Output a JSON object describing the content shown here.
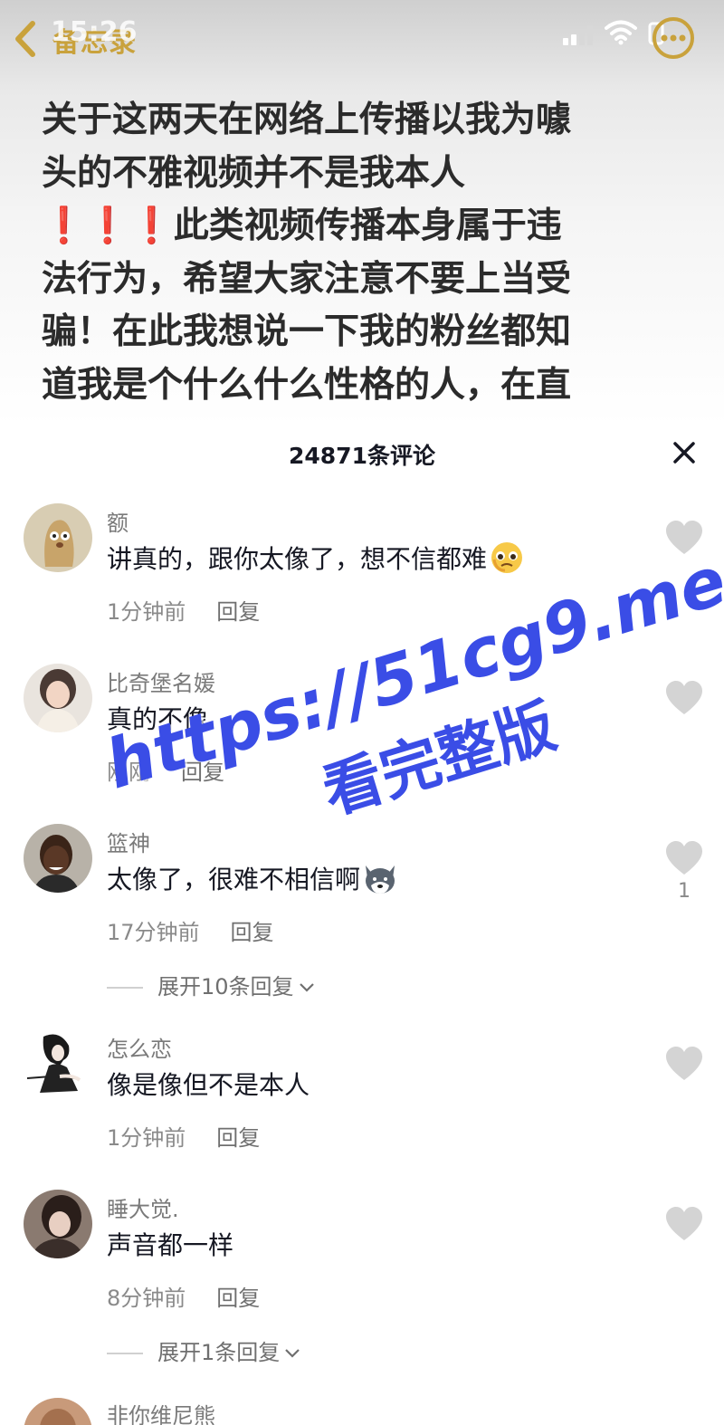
{
  "status_bar": {
    "time": "15:26",
    "back_label": "备忘录"
  },
  "post": {
    "line1": "关于这两天在网络上传播以我为噱",
    "line2": "头的不雅视频并不是我本人",
    "exclamations": "❗❗❗",
    "line3_rest": "此类视频传播本身属于违",
    "line4": "法行为，希望大家注意不要上当受",
    "line5": "骗！在此我想说一下我的粉丝都知",
    "line6": "道我是个什么什么性格的人，在直"
  },
  "comments_panel": {
    "title": "24871条评论",
    "reply_label": "回复",
    "comments": [
      {
        "username": "额",
        "text": "讲真的，跟你太像了，想不信都难",
        "emoji": "pleading-face-emoji",
        "time": "1分钟前",
        "likes": ""
      },
      {
        "username": "比奇堡名媛",
        "text": "真的不像",
        "time": "刚刚",
        "likes": ""
      },
      {
        "username": "篮神",
        "text": "太像了，很难不相信啊",
        "emoji": "husky-face-emoji",
        "time": "17分钟前",
        "likes": "1",
        "expand": "展开10条回复"
      },
      {
        "username": "怎么恋",
        "text": "像是像但不是本人",
        "time": "1分钟前",
        "likes": ""
      },
      {
        "username": "睡大觉.",
        "text": "声音都一样",
        "time": "8分钟前",
        "likes": "",
        "expand": "展开1条回复"
      },
      {
        "username": "非你维尼熊",
        "text": "",
        "time": ""
      }
    ]
  },
  "watermark": {
    "url": "https://51cg9.me",
    "subtitle": "看完整版"
  },
  "colors": {
    "accent_gold": "#c9a23c",
    "watermark_blue": "#3a4de6",
    "exclamation_red": "#e8202f"
  }
}
